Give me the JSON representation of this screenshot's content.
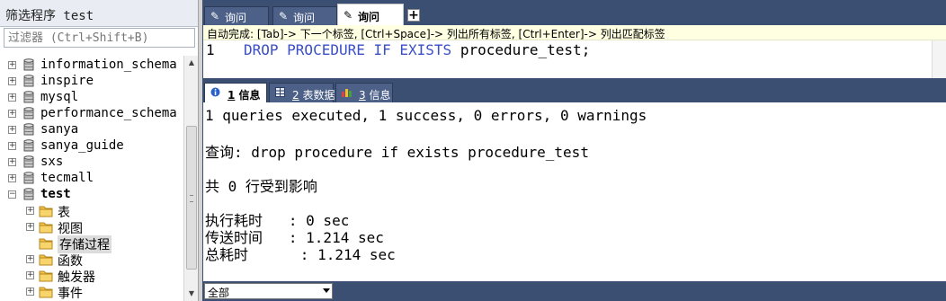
{
  "left_panel": {
    "title": "筛选程序 test",
    "filter_placeholder": "过滤器 (Ctrl+Shift+B)",
    "tree": [
      {
        "label": "information_schema",
        "type": "database",
        "expander": "+"
      },
      {
        "label": "inspire",
        "type": "database",
        "expander": "+"
      },
      {
        "label": "mysql",
        "type": "database",
        "expander": "+"
      },
      {
        "label": "performance_schema",
        "type": "database",
        "expander": "+"
      },
      {
        "label": "sanya",
        "type": "database",
        "expander": "+"
      },
      {
        "label": "sanya_guide",
        "type": "database",
        "expander": "+"
      },
      {
        "label": "sxs",
        "type": "database",
        "expander": "+"
      },
      {
        "label": "tecmall",
        "type": "database",
        "expander": "+"
      },
      {
        "label": "test",
        "type": "database",
        "expander": "−",
        "bold": true
      },
      {
        "label": "表",
        "type": "folder",
        "expander": "+"
      },
      {
        "label": "视图",
        "type": "folder",
        "expander": "+"
      },
      {
        "label": "存储过程",
        "type": "folder",
        "expander": "",
        "selected": true
      },
      {
        "label": "函数",
        "type": "folder",
        "expander": "+"
      },
      {
        "label": "触发器",
        "type": "folder",
        "expander": "+"
      },
      {
        "label": "事件",
        "type": "folder",
        "expander": "+"
      }
    ]
  },
  "editor": {
    "tabs": [
      {
        "label": "询问",
        "active": false
      },
      {
        "label": "询问",
        "active": false
      },
      {
        "label": "询问",
        "active": true
      }
    ],
    "add_tab": "+",
    "hint": "自动完成: [Tab]-> 下一个标签, [Ctrl+Space]-> 列出所有标签, [Ctrl+Enter]-> 列出匹配标签",
    "line_number": "1",
    "code_keywords": "DROP PROCEDURE IF EXISTS ",
    "code_identifier": "procedure_test",
    "code_end": ";"
  },
  "result_tabs": [
    {
      "num": "1",
      "label": " 信息",
      "active": true,
      "icon": "info-icon"
    },
    {
      "num": "2",
      "label": " 表数据",
      "active": false,
      "icon": "table-icon"
    },
    {
      "num": "3",
      "label": " 信息",
      "active": false,
      "icon": "stats-icon"
    }
  ],
  "output": {
    "summary": "1 queries executed, 1 success, 0 errors, 0 warnings",
    "query": "查询: drop procedure if exists procedure_test",
    "affected": "共 0 行受到影响",
    "exec_time": "执行耗时   : 0 sec",
    "transfer_time": "传送时间   : 1.214 sec",
    "total_time": "总耗时      : 1.214 sec"
  },
  "bottom": {
    "filter_select": "全部"
  },
  "colors": {
    "panel_bg": "#3b4f73",
    "keyword": "#3a4fc6",
    "hint_bg": "#ffffe1"
  }
}
